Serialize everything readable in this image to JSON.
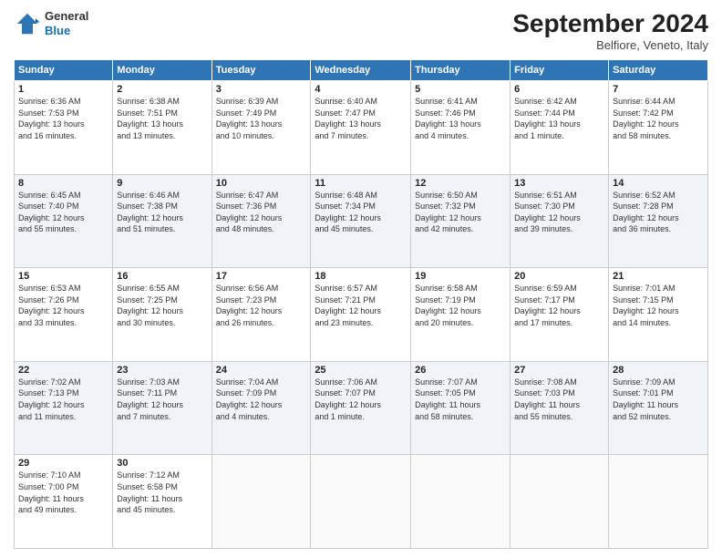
{
  "header": {
    "logo": {
      "general": "General",
      "blue": "Blue"
    },
    "month_title": "September 2024",
    "subtitle": "Belfiore, Veneto, Italy"
  },
  "weekdays": [
    "Sunday",
    "Monday",
    "Tuesday",
    "Wednesday",
    "Thursday",
    "Friday",
    "Saturday"
  ],
  "weeks": [
    [
      {
        "day": "1",
        "info": "Sunrise: 6:36 AM\nSunset: 7:53 PM\nDaylight: 13 hours\nand 16 minutes."
      },
      {
        "day": "2",
        "info": "Sunrise: 6:38 AM\nSunset: 7:51 PM\nDaylight: 13 hours\nand 13 minutes."
      },
      {
        "day": "3",
        "info": "Sunrise: 6:39 AM\nSunset: 7:49 PM\nDaylight: 13 hours\nand 10 minutes."
      },
      {
        "day": "4",
        "info": "Sunrise: 6:40 AM\nSunset: 7:47 PM\nDaylight: 13 hours\nand 7 minutes."
      },
      {
        "day": "5",
        "info": "Sunrise: 6:41 AM\nSunset: 7:46 PM\nDaylight: 13 hours\nand 4 minutes."
      },
      {
        "day": "6",
        "info": "Sunrise: 6:42 AM\nSunset: 7:44 PM\nDaylight: 13 hours\nand 1 minute."
      },
      {
        "day": "7",
        "info": "Sunrise: 6:44 AM\nSunset: 7:42 PM\nDaylight: 12 hours\nand 58 minutes."
      }
    ],
    [
      {
        "day": "8",
        "info": "Sunrise: 6:45 AM\nSunset: 7:40 PM\nDaylight: 12 hours\nand 55 minutes."
      },
      {
        "day": "9",
        "info": "Sunrise: 6:46 AM\nSunset: 7:38 PM\nDaylight: 12 hours\nand 51 minutes."
      },
      {
        "day": "10",
        "info": "Sunrise: 6:47 AM\nSunset: 7:36 PM\nDaylight: 12 hours\nand 48 minutes."
      },
      {
        "day": "11",
        "info": "Sunrise: 6:48 AM\nSunset: 7:34 PM\nDaylight: 12 hours\nand 45 minutes."
      },
      {
        "day": "12",
        "info": "Sunrise: 6:50 AM\nSunset: 7:32 PM\nDaylight: 12 hours\nand 42 minutes."
      },
      {
        "day": "13",
        "info": "Sunrise: 6:51 AM\nSunset: 7:30 PM\nDaylight: 12 hours\nand 39 minutes."
      },
      {
        "day": "14",
        "info": "Sunrise: 6:52 AM\nSunset: 7:28 PM\nDaylight: 12 hours\nand 36 minutes."
      }
    ],
    [
      {
        "day": "15",
        "info": "Sunrise: 6:53 AM\nSunset: 7:26 PM\nDaylight: 12 hours\nand 33 minutes."
      },
      {
        "day": "16",
        "info": "Sunrise: 6:55 AM\nSunset: 7:25 PM\nDaylight: 12 hours\nand 30 minutes."
      },
      {
        "day": "17",
        "info": "Sunrise: 6:56 AM\nSunset: 7:23 PM\nDaylight: 12 hours\nand 26 minutes."
      },
      {
        "day": "18",
        "info": "Sunrise: 6:57 AM\nSunset: 7:21 PM\nDaylight: 12 hours\nand 23 minutes."
      },
      {
        "day": "19",
        "info": "Sunrise: 6:58 AM\nSunset: 7:19 PM\nDaylight: 12 hours\nand 20 minutes."
      },
      {
        "day": "20",
        "info": "Sunrise: 6:59 AM\nSunset: 7:17 PM\nDaylight: 12 hours\nand 17 minutes."
      },
      {
        "day": "21",
        "info": "Sunrise: 7:01 AM\nSunset: 7:15 PM\nDaylight: 12 hours\nand 14 minutes."
      }
    ],
    [
      {
        "day": "22",
        "info": "Sunrise: 7:02 AM\nSunset: 7:13 PM\nDaylight: 12 hours\nand 11 minutes."
      },
      {
        "day": "23",
        "info": "Sunrise: 7:03 AM\nSunset: 7:11 PM\nDaylight: 12 hours\nand 7 minutes."
      },
      {
        "day": "24",
        "info": "Sunrise: 7:04 AM\nSunset: 7:09 PM\nDaylight: 12 hours\nand 4 minutes."
      },
      {
        "day": "25",
        "info": "Sunrise: 7:06 AM\nSunset: 7:07 PM\nDaylight: 12 hours\nand 1 minute."
      },
      {
        "day": "26",
        "info": "Sunrise: 7:07 AM\nSunset: 7:05 PM\nDaylight: 11 hours\nand 58 minutes."
      },
      {
        "day": "27",
        "info": "Sunrise: 7:08 AM\nSunset: 7:03 PM\nDaylight: 11 hours\nand 55 minutes."
      },
      {
        "day": "28",
        "info": "Sunrise: 7:09 AM\nSunset: 7:01 PM\nDaylight: 11 hours\nand 52 minutes."
      }
    ],
    [
      {
        "day": "29",
        "info": "Sunrise: 7:10 AM\nSunset: 7:00 PM\nDaylight: 11 hours\nand 49 minutes."
      },
      {
        "day": "30",
        "info": "Sunrise: 7:12 AM\nSunset: 6:58 PM\nDaylight: 11 hours\nand 45 minutes."
      },
      {
        "day": "",
        "info": ""
      },
      {
        "day": "",
        "info": ""
      },
      {
        "day": "",
        "info": ""
      },
      {
        "day": "",
        "info": ""
      },
      {
        "day": "",
        "info": ""
      }
    ]
  ]
}
